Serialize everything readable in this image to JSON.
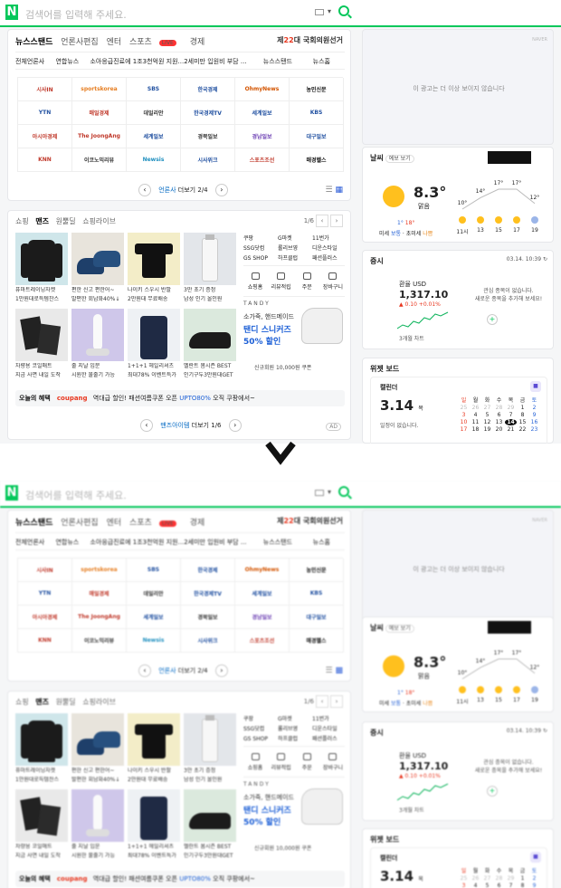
{
  "search": {
    "placeholder": "검색어를 입력해 주세요."
  },
  "news": {
    "tabs": [
      "뉴스스탠드",
      "언론사편집",
      "엔터",
      "스포츠",
      "경제"
    ],
    "live_label": "LIVE",
    "election_prefix": "제",
    "election_num": "22",
    "election_suffix": "대 국회의원선거",
    "ticker": {
      "label": "전체언론사",
      "source": "연합뉴스",
      "headline": "소아응급진료에 1조3천억원 지원...2세미만 입원비 부담 ...",
      "standlink": "뉴스스탠드",
      "homelink": "뉴스홈"
    },
    "press": [
      "시사IN",
      "sportskorea",
      "SBS",
      "한국경제",
      "OhmyNews",
      "농민신문",
      "YTN",
      "매일경제",
      "데일리안",
      "한국경제TV",
      "세계일보",
      "KBS",
      "아시아경제",
      "The JoongAng",
      "세계일보",
      "경북일보",
      "경남일보",
      "대구일보",
      "KNN",
      "이코노믹리뷰",
      "Newsis",
      "시사위크",
      "스포츠조선",
      "매경헬스"
    ],
    "pager": {
      "press_label": "언론사",
      "more": "더보기",
      "page": "2/4"
    }
  },
  "shopping": {
    "tabs": [
      "쇼핑",
      "맨즈",
      "원뿔딜",
      "쇼핑라이브"
    ],
    "page": "1/6",
    "products": [
      {
        "name": "퓨마트레이닝자켓",
        "sub": "1만원대로득템찬스"
      },
      {
        "name": "편한 신고 편한어~",
        "sub": "발편한 회남화40%↓"
      },
      {
        "name": "나이키 스우시 반팔",
        "sub": "2만원대 무료배송"
      },
      {
        "name": "3만 초기 증정",
        "sub": "남성 인기 올인원"
      },
      {
        "name": "차량용 코일매트",
        "sub": "지금 사면 내일 도착"
      },
      {
        "name": "줄 지날 입문",
        "sub": "시원한 물줄기 가능"
      },
      {
        "name": "1+1+1 헤일리셔츠",
        "sub": "최대78% 이벤트특가"
      },
      {
        "name": "멜란트 봄시즌 BEST",
        "sub": "인기구두3만원대GET"
      }
    ],
    "malls": [
      "쿠팡",
      "G마켓",
      "11번가",
      "SSG닷컴",
      "롤리브영",
      "디운스타일",
      "GS SHOP",
      "하프클럽",
      "패션플러스"
    ],
    "mall_icons": [
      "쇼핑홈",
      "리뷰적립",
      "주문",
      "장바구니"
    ],
    "tandy": {
      "brand": "TANDY",
      "line1": "소가죽, 핸드메이드",
      "line2": "탠디 스니커즈",
      "line3": "50% 할인",
      "note": "신규회원 10,000원 쿠폰"
    },
    "benefit": {
      "label": "오늘의 혜택",
      "coupang": "coupang",
      "text": "역대급 할인! 패션여름쿠폰 오픈",
      "upto": "UPTO80%",
      "tail": "오직 쿠팡에서~"
    },
    "pager": {
      "mall_label": "맨즈아이템",
      "more": "더보기",
      "page": "1/6"
    },
    "ad": "AD"
  },
  "right": {
    "ad_tag": "NAVER",
    "ad_message": "이 광고는 더 이상 보이지 않습니다",
    "weather": {
      "title": "날씨",
      "sub": "예보 보기",
      "temp": "8.3°",
      "cond": "맑음",
      "min": "1°",
      "max": "18°",
      "dust_label": "미세",
      "dust_val": "보통",
      "fine_label": "초미세",
      "fine_val": "나쁨",
      "hourly": [
        {
          "t": "10°",
          "h": "11시"
        },
        {
          "t": "14°",
          "h": "13"
        },
        {
          "t": "17°",
          "h": "15"
        },
        {
          "t": "17°",
          "h": "17"
        },
        {
          "t": "12°",
          "h": "19"
        }
      ]
    },
    "stock": {
      "title": "증시",
      "time": "03.14. 10:39",
      "fx_name": "환율 USD",
      "fx_value": "1,317.10",
      "fx_change": "▲ 0.10 +0.01%",
      "period": "3개월 차트",
      "empty1": "관심 종목이 없습니다.",
      "empty2": "새로운 종목을 추가해 보세요!"
    },
    "widget": {
      "title": "위젯 보드",
      "cal_label": "캘린더",
      "day": "3.14",
      "dow": "목",
      "empty": "일정이 없습니다.",
      "heads": [
        "일",
        "월",
        "화",
        "수",
        "목",
        "금",
        "토"
      ],
      "days": [
        "25",
        "26",
        "27",
        "28",
        "29",
        "1",
        "2",
        "3",
        "4",
        "5",
        "6",
        "7",
        "8",
        "9",
        "10",
        "11",
        "12",
        "13",
        "14",
        "15",
        "16",
        "17",
        "18",
        "19",
        "20",
        "21",
        "22",
        "23"
      ]
    }
  }
}
